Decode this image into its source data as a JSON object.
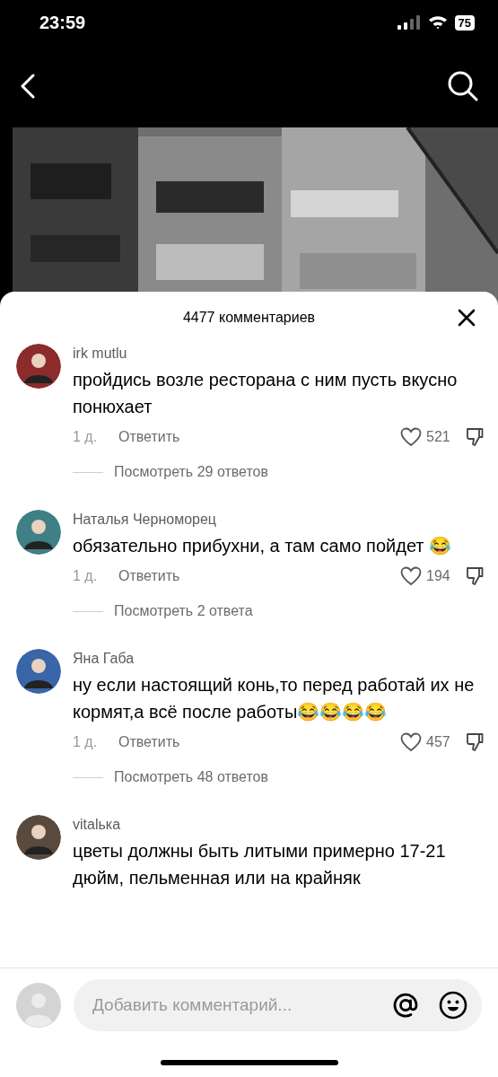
{
  "status_bar": {
    "time": "23:59",
    "battery": "75"
  },
  "sheet": {
    "title": "4477 комментариев"
  },
  "comments": [
    {
      "author": "irk mutlu",
      "text": "пройдись возле ресторана с ним пусть вкусно понюхает",
      "time": "1 д.",
      "reply": "Ответить",
      "likes": "521",
      "view_replies": "Посмотреть 29 ответов"
    },
    {
      "author": "Наталья Черноморец",
      "text": "обязательно прибухни, а там само пойдет 😂",
      "time": "1 д.",
      "reply": "Ответить",
      "likes": "194",
      "view_replies": "Посмотреть 2 ответа"
    },
    {
      "author": "Яна Габа",
      "text": "ну если настоящий конь,то перед работай их не кормят,а всё после работы😂😂😂😂",
      "time": "1 д.",
      "reply": "Ответить",
      "likes": "457",
      "view_replies": "Посмотреть 48 ответов"
    },
    {
      "author": "vitalька",
      "text": "цветы должны быть литыми примерно 17-21 дюйм, пельменная или на крайняк"
    }
  ],
  "comment_input": {
    "placeholder": "Добавить комментарий..."
  }
}
